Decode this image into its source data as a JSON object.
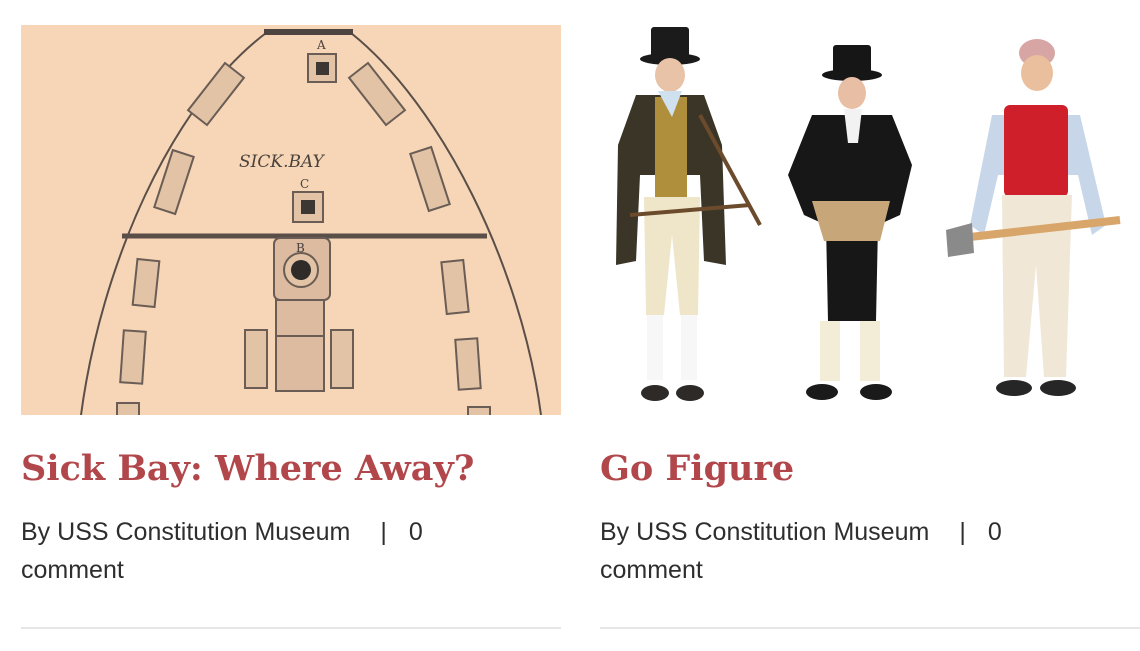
{
  "posts": [
    {
      "title": "Sick Bay: Where Away?",
      "by": "By",
      "author": "USS Constitution Museum",
      "separator": "|",
      "comment_count": "0",
      "comment_word": "comment",
      "image": {
        "kind": "ship plan drawing",
        "labels": {
          "caption": "SICK.BAY",
          "a": "A",
          "b": "B",
          "c": "C"
        }
      }
    },
    {
      "title": "Go Figure",
      "by": "By",
      "author": "USS Constitution Museum",
      "separator": "|",
      "comment_count": "0",
      "comment_word": "comment",
      "image": {
        "kind": "three costumed reenactors"
      }
    }
  ],
  "colors": {
    "title": "#b2474b",
    "meta": "#2e2e2e",
    "map_paper": "#f6d6b6",
    "divider": "#e6e6e6"
  }
}
